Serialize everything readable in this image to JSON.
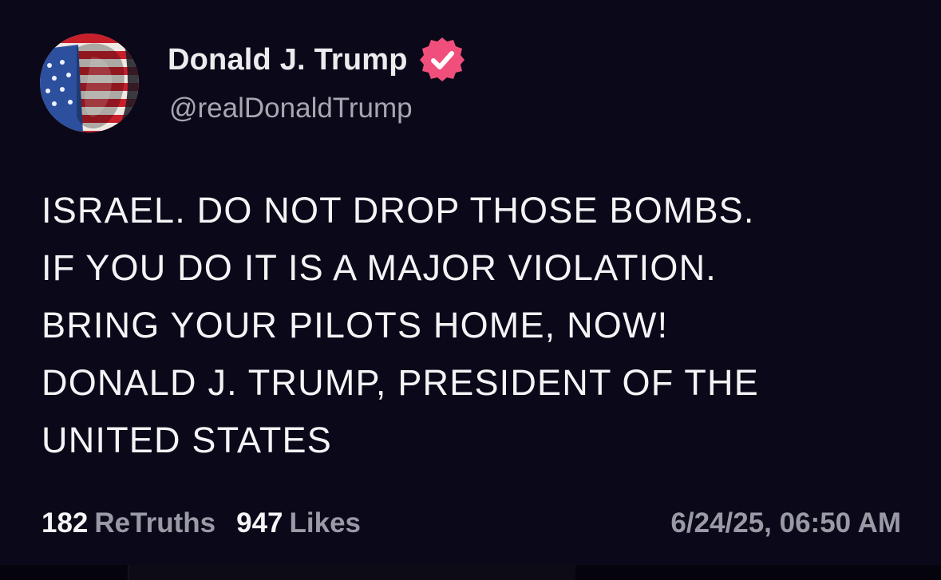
{
  "author": {
    "display_name": "Donald J. Trump",
    "handle": "@realDonaldTrump",
    "verified_icon": "verified-badge-icon",
    "avatar_icon": "profile-avatar"
  },
  "post": {
    "lines": [
      "ISRAEL. DO NOT DROP THOSE BOMBS.",
      "IF YOU DO IT IS A MAJOR VIOLATION.",
      "BRING YOUR PILOTS HOME, NOW!",
      "DONALD J. TRUMP, PRESIDENT OF THE",
      "UNITED STATES"
    ]
  },
  "stats": {
    "retruths_count": "182",
    "retruths_label": "ReTruths",
    "likes_count": "947",
    "likes_label": "Likes"
  },
  "timestamp": "6/24/25, 06:50 AM",
  "colors": {
    "background": "#0b0919",
    "text": "#f4f4f6",
    "muted": "#9a9aa6",
    "verified_badge": "#f04f7c"
  }
}
